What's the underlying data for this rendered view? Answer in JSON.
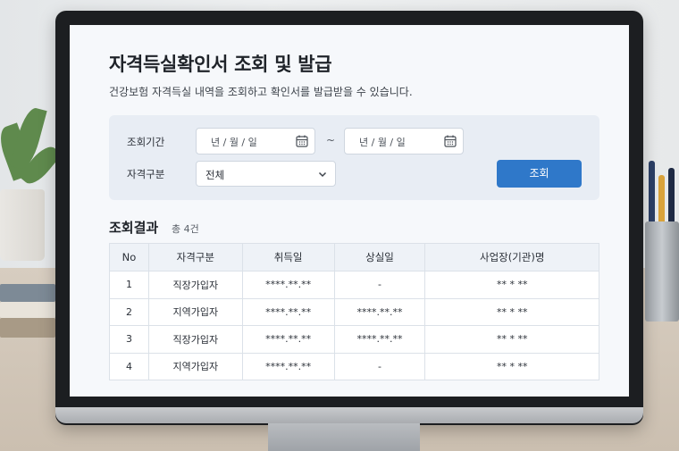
{
  "page": {
    "title": "자격득실확인서 조회 및 발급",
    "description": "건강보험 자격득실 내역을 조회하고 확인서를 발급받을 수 있습니다."
  },
  "filter": {
    "period_label": "조회기간",
    "start_date_placeholder": "년 / 월 / 일",
    "separator": "~",
    "end_date_placeholder": "년 / 월 / 일",
    "type_label": "자격구분",
    "type_selected": "전체",
    "search_button": "조회"
  },
  "results": {
    "title": "조회결과",
    "count": "총 4건",
    "columns": [
      "No",
      "자격구분",
      "취득일",
      "상실일",
      "사업장(기관)명"
    ],
    "rows": [
      [
        "1",
        "직장가입자",
        "****.**.**",
        "-",
        "** * **"
      ],
      [
        "2",
        "지역가입자",
        "****.**.**",
        "****.**.**",
        "** * **"
      ],
      [
        "3",
        "직장가입자",
        "****.**.**",
        "****.**.**",
        "** * **"
      ],
      [
        "4",
        "지역가입자",
        "****.**.**",
        "-",
        "** * **"
      ]
    ]
  },
  "colors": {
    "accent": "#2f78c9",
    "panel": "#e8edf4",
    "screen_bg": "#f6f8fb"
  },
  "icons": [
    "calendar-icon",
    "chevron-down-icon"
  ]
}
